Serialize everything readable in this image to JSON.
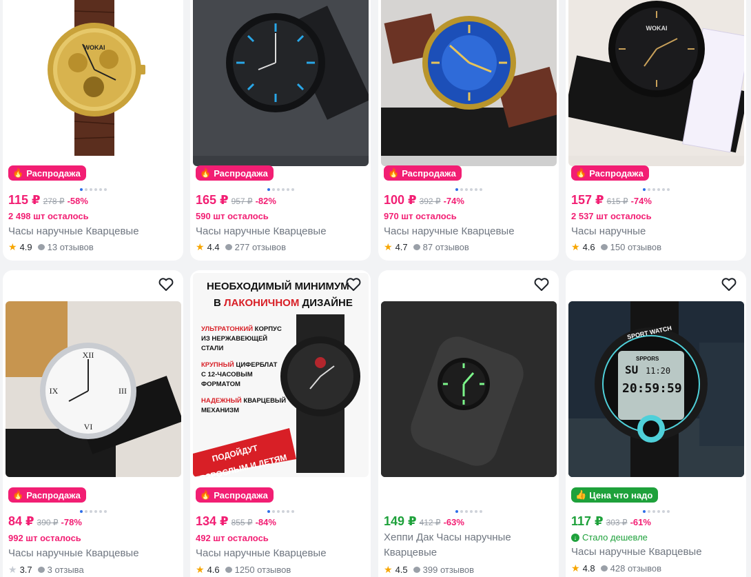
{
  "products": [
    {
      "badge": "Распродажа",
      "price": "115 ₽",
      "old_price": "278 ₽",
      "discount": "-58%",
      "left": "2 498 шт осталось",
      "title": "Часы наручные Кварцевые",
      "rating": "4.9",
      "reviews": "13 отзывов",
      "image": "gold-chronograph-watch-brown-strap"
    },
    {
      "badge": "Распродажа",
      "price": "165 ₽",
      "old_price": "957 ₽",
      "discount": "-82%",
      "left": "590 шт осталось",
      "title": "Часы наручные Кварцевые",
      "rating": "4.4",
      "reviews": "277 отзывов",
      "image": "black-mesh-watch-blue-markers"
    },
    {
      "badge": "Распродажа",
      "price": "100 ₽",
      "old_price": "392 ₽",
      "discount": "-74%",
      "left": "970 шт осталось",
      "title": "Часы наручные Кварцевые",
      "rating": "4.7",
      "reviews": "87 отзывов",
      "image": "blue-dial-gold-watch-brown-strap"
    },
    {
      "badge": "Распродажа",
      "price": "157 ₽",
      "old_price": "615 ₽",
      "discount": "-74%",
      "left": "2 537 шт осталось",
      "title": "Часы наручные",
      "rating": "4.6",
      "reviews": "150 отзывов",
      "image": "black-watch-with-price-tag"
    },
    {
      "badge": "Распродажа",
      "price": "84 ₽",
      "old_price": "390 ₽",
      "discount": "-78%",
      "left": "992 шт осталось",
      "title": "Часы наручные Кварцевые",
      "rating": "3.7",
      "reviews": "3 отзыва",
      "image": "white-roman-dial-watch"
    },
    {
      "badge": "Распродажа",
      "price": "134 ₽",
      "old_price": "855 ₽",
      "discount": "-84%",
      "left": "492 шт осталось",
      "title": "Часы наручные Кварцевые",
      "rating": "4.6",
      "reviews": "1250 отзывов",
      "image": "military-watch-promo",
      "promo": {
        "headline1": "НЕОБХОДИМЫЙ МИНИМУМ",
        "headline2_a": "В ",
        "headline2_b": "ЛАКОНИЧНОМ",
        "headline2_c": " ДИЗАЙНЕ",
        "f1_red": "УЛЬТРАТОНКИЙ",
        "f1_rest": " КОРПУС",
        "f1_l2": "ИЗ НЕРЖАВЕЮЩЕЙ",
        "f1_l3": "СТАЛИ",
        "f2_red": "КРУПНЫЙ",
        "f2_rest": " ЦИФЕРБЛАТ",
        "f2_l2": "С 12-ЧАСОВЫМ",
        "f2_l3": "ФОРМАТОМ",
        "f3_red": "НАДЕЖНЫЙ",
        "f3_rest": " КВАРЦЕВЫЙ",
        "f3_l2": "МЕХАНИЗМ",
        "banner1": "ПОДОЙДУТ",
        "banner2": "ВЗРОСЛЫМ И ДЕТЯМ"
      }
    },
    {
      "badge": "",
      "price": "149 ₽",
      "old_price": "412 ₽",
      "discount": "-63%",
      "left": "",
      "title": "Хеппи Дак Часы наручные Кварцевые",
      "rating": "4.5",
      "reviews": "399 отзывов",
      "image": "glowing-watch-dark"
    },
    {
      "badge": "Цена что надо",
      "price": "117 ₽",
      "old_price": "303 ₽",
      "discount": "-61%",
      "left": "",
      "cheaper": "Стало дешевле",
      "title": "Часы наручные Кварцевые",
      "rating": "4.8",
      "reviews": "428 отзывов",
      "image": "sport-digital-watch",
      "sport": {
        "ring": "SPORT WATCH",
        "brand": "SPPORS",
        "day": "SU",
        "time_small": "11:20",
        "time_big": "20:59:59"
      }
    }
  ],
  "colors": {
    "sale": "#f21e73",
    "good": "#1ea13b",
    "star": "#f7a600"
  }
}
